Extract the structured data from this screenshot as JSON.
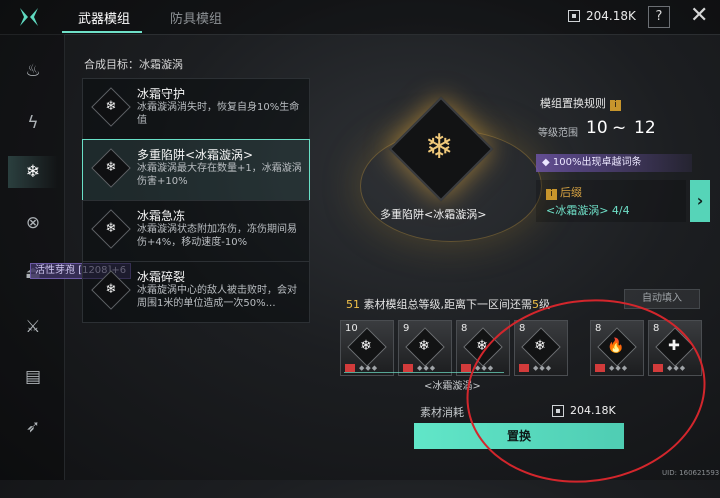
{
  "header": {
    "tabs": [
      {
        "label": "武器模组",
        "active": true
      },
      {
        "label": "防具模组",
        "active": false
      }
    ],
    "currency_value": "204.18K",
    "help_label": "?",
    "close_label": "✕"
  },
  "rail": {
    "icons": [
      "fire-icon",
      "lightning-icon",
      "frost-icon",
      "target-icon",
      "totem-icon",
      "swords-icon",
      "ammo-icon",
      "arrow-icon"
    ],
    "active_index": 2,
    "tooltip": "活性芽孢 [1208]+6"
  },
  "target": {
    "title": "合成目标：冰霜漩涡",
    "items": [
      {
        "name": "冰霜守护",
        "desc": "冰霜漩涡消失时，恢复自身10%生命值",
        "selected": false
      },
      {
        "name": "多重陷阱<冰霜漩涡>",
        "desc": "冰霜漩涡最大存在数量+1，冰霜漩涡伤害+10%",
        "selected": true
      },
      {
        "name": "冰霜急冻",
        "desc": "冰霜漩涡状态附加冻伤，冻伤期间易伤+4%，移动速度-10%",
        "selected": false
      },
      {
        "name": "冰霜碎裂",
        "desc": "冰霜旋涡中心的敌人被击败时，会对周围1米的单位造成一次50%…",
        "selected": false
      }
    ]
  },
  "center": {
    "label": "多重陷阱<冰霜漩涡>"
  },
  "rules": {
    "title": "模组置换规则",
    "range_label": "等级范围",
    "range_from": "10",
    "range_sep": "~",
    "range_to": "12",
    "chance": "100%出现卓越词条",
    "suffix_title": "后缀",
    "suffix_line": "<冰霜漩涡> 4/4",
    "next_label": "›"
  },
  "materials": {
    "count": "51",
    "header_text": "素材模组总等级,距离下一区间还需",
    "header_need": "5",
    "header_unit": "级",
    "auto_fill": "自动填入",
    "slots": [
      {
        "level": "10",
        "glyph": "❄"
      },
      {
        "level": "9",
        "glyph": "❄"
      },
      {
        "level": "8",
        "glyph": "❄"
      },
      {
        "level": "8",
        "glyph": "❄"
      },
      {
        "level": "8",
        "glyph": "🔥"
      },
      {
        "level": "8",
        "glyph": "✚"
      }
    ],
    "group_label": "<冰霜漩涡>",
    "cost_label": "素材消耗",
    "cost_value": "204.18K",
    "replace_label": "置换"
  },
  "footer": {
    "uid": "UID: 160621593"
  },
  "colors": {
    "accent": "#6fe0c8",
    "gold": "#d9a442",
    "annotation_red": "#d3262c"
  }
}
